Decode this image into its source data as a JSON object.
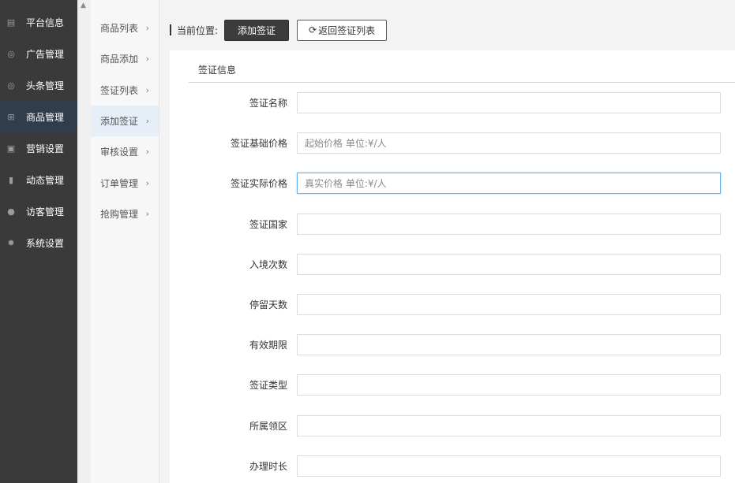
{
  "sidebar": {
    "items": [
      {
        "label": "平台信息",
        "icon": "newspaper-icon",
        "glyph": "▤",
        "active": false
      },
      {
        "label": "广告管理",
        "icon": "lifebuoy-icon",
        "glyph": "◎",
        "active": false
      },
      {
        "label": "头条管理",
        "icon": "lifebuoy-icon",
        "glyph": "◎",
        "active": false
      },
      {
        "label": "商品管理",
        "icon": "cart-icon",
        "glyph": "⊞",
        "active": true
      },
      {
        "label": "营销设置",
        "icon": "gift-icon",
        "glyph": "▣",
        "active": false
      },
      {
        "label": "动态管理",
        "icon": "book-icon",
        "glyph": "▮",
        "active": false
      },
      {
        "label": "访客管理",
        "icon": "user-icon",
        "glyph": "●",
        "active": false
      },
      {
        "label": "系统设置",
        "icon": "gear-icon",
        "glyph": "✹",
        "active": false
      }
    ]
  },
  "submenu": {
    "items": [
      {
        "label": "商品列表",
        "active": false
      },
      {
        "label": "商品添加",
        "active": false
      },
      {
        "label": "签证列表",
        "active": false
      },
      {
        "label": "添加签证",
        "active": true
      },
      {
        "label": "审核设置",
        "active": false
      },
      {
        "label": "订单管理",
        "active": false
      },
      {
        "label": "抢购管理",
        "active": false
      }
    ],
    "chevron": "›"
  },
  "header": {
    "crumb_label": "当前位置:",
    "current_button": "添加签证",
    "back_button": "返回签证列表",
    "back_icon": "refresh-icon"
  },
  "form": {
    "section_title": "签证信息",
    "fields": [
      {
        "label": "签证名称",
        "value": "",
        "placeholder": "",
        "focused": false
      },
      {
        "label": "签证基础价格",
        "value": "",
        "placeholder": "起始价格 单位:¥/人",
        "focused": false
      },
      {
        "label": "签证实际价格",
        "value": "",
        "placeholder": "真实价格 单位:¥/人",
        "focused": true
      },
      {
        "label": "签证国家",
        "value": "",
        "placeholder": "",
        "focused": false
      },
      {
        "label": "入境次数",
        "value": "",
        "placeholder": "",
        "focused": false
      },
      {
        "label": "停留天数",
        "value": "",
        "placeholder": "",
        "focused": false
      },
      {
        "label": "有效期限",
        "value": "",
        "placeholder": "",
        "focused": false
      },
      {
        "label": "签证类型",
        "value": "",
        "placeholder": "",
        "focused": false
      },
      {
        "label": "所属领区",
        "value": "",
        "placeholder": "",
        "focused": false
      },
      {
        "label": "办理时长",
        "value": "",
        "placeholder": "",
        "focused": false
      }
    ]
  },
  "colors": {
    "sidebar_bg": "#3a3a3a",
    "sidebar_active": "#2f3d4d",
    "focus_border": "#66afe9"
  }
}
